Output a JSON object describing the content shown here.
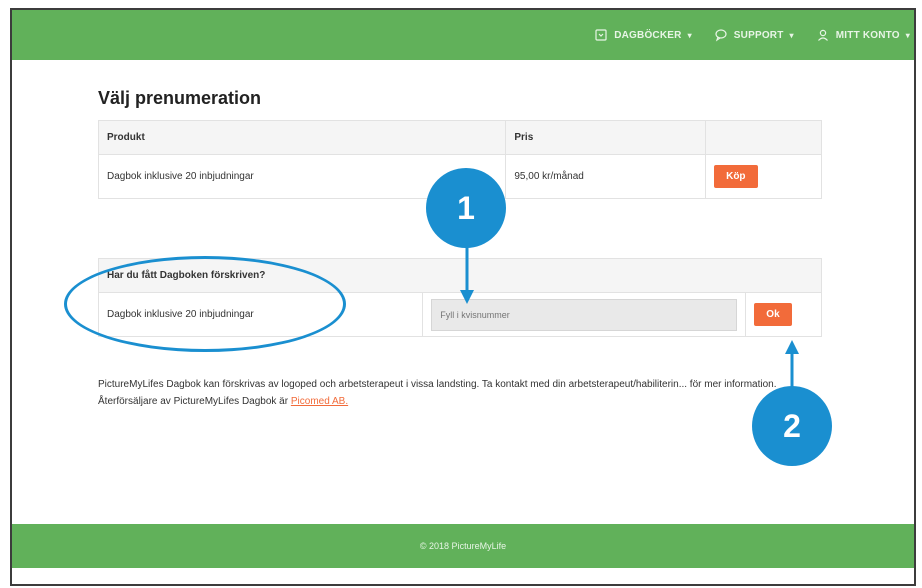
{
  "nav": {
    "items": [
      {
        "label": "DAGBÖCKER",
        "icon": "book-icon"
      },
      {
        "label": "SUPPORT",
        "icon": "chat-bubble-icon"
      },
      {
        "label": "MITT KONTO",
        "icon": "user-icon"
      }
    ],
    "caret": "▾"
  },
  "page": {
    "title": "Välj prenumeration"
  },
  "plans": {
    "headers": [
      "Produkt",
      "Pris",
      ""
    ],
    "row": {
      "product": "Dagbok inklusive 20 inbjudningar",
      "price": "95,00 kr/månad",
      "buy_label": "Köp"
    }
  },
  "prescribed": {
    "header": "Har du fått Dagboken förskriven?",
    "product": "Dagbok inklusive 20 inbjudningar",
    "input_placeholder": "Fyll i kvisnummer",
    "ok_label": "Ok"
  },
  "info": {
    "text": "PictureMyLifes Dagbok kan förskrivas av logoped och arbetsterapeut i vissa landsting. Ta kontakt med din arbetsterapeut/habiliterin... för mer information. Återförsäljare av PictureMyLifes Dagbok är ",
    "link": "Picomed AB."
  },
  "footer": {
    "text": "© 2018 PictureMyLife"
  },
  "annotations": {
    "badge1": "1",
    "badge2": "2"
  },
  "colors": {
    "green": "#61b15a",
    "orange": "#f26b3a",
    "annotation_blue": "#1a8fd0"
  }
}
